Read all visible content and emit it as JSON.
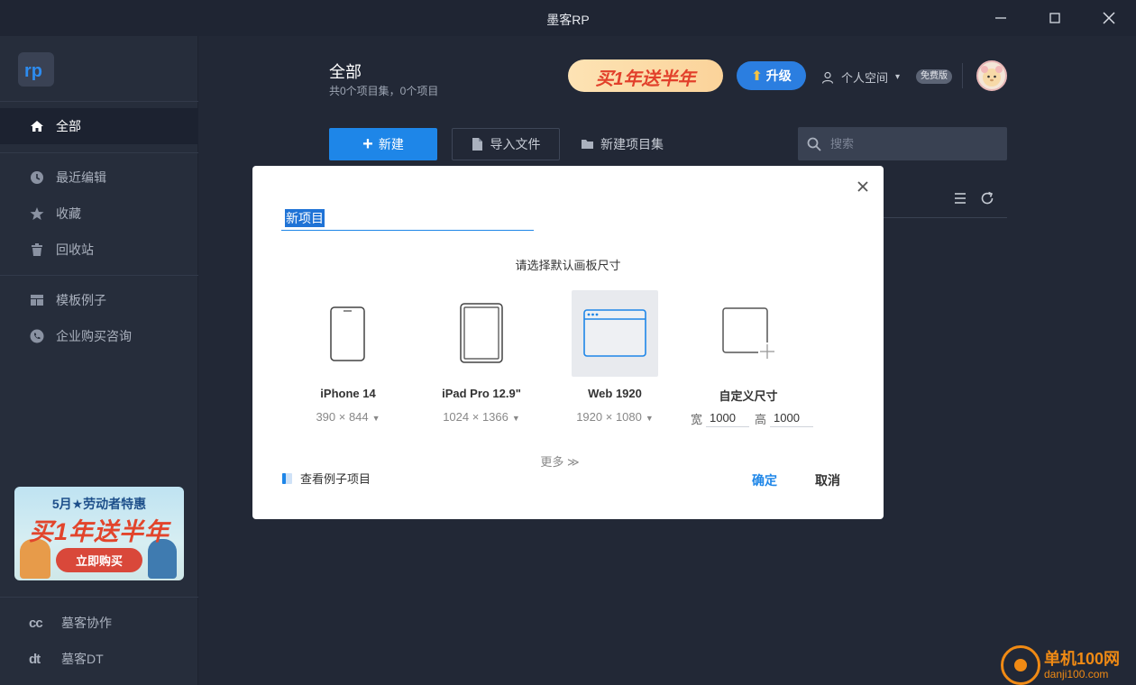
{
  "window": {
    "title": "墨客RP"
  },
  "sidebar": {
    "items": [
      {
        "label": "全部",
        "icon": "home-icon"
      },
      {
        "label": "最近编辑",
        "icon": "clock-icon"
      },
      {
        "label": "收藏",
        "icon": "star-icon"
      },
      {
        "label": "回收站",
        "icon": "trash-icon"
      },
      {
        "label": "模板例子",
        "icon": "template-icon"
      },
      {
        "label": "企业购买咨询",
        "icon": "phone-icon"
      }
    ],
    "promo": {
      "line1": "5月★劳动者特惠",
      "line2": "买1年送半年",
      "button": "立即购买"
    },
    "bottom": [
      {
        "label": "墓客协作",
        "icon_text": "cc"
      },
      {
        "label": "墓客DT",
        "icon_text": "dt"
      }
    ]
  },
  "header": {
    "title": "全部",
    "subtitle": "共0个项目集，0个项目",
    "banner": "买1年送半年",
    "upgrade": "升级",
    "space": "个人空间",
    "badge": "免费版"
  },
  "toolbar": {
    "new_label": "新建",
    "import_label": "导入文件",
    "new_set_label": "新建项目集",
    "search_placeholder": "搜索"
  },
  "dialog": {
    "name_value": "新项目",
    "choose_label": "请选择默认画板尺寸",
    "cards": [
      {
        "name": "iPhone 14",
        "size": "390 × 844"
      },
      {
        "name": "iPad Pro 12.9\"",
        "size": "1024 × 1366"
      },
      {
        "name": "Web 1920",
        "size": "1920 × 1080"
      },
      {
        "name": "自定义尺寸",
        "width_label": "宽",
        "width": "1000",
        "height_label": "高",
        "height": "1000"
      }
    ],
    "selected": "Web 1920",
    "more": "更多 ≫",
    "example": "查看例子项目",
    "ok": "确定",
    "cancel": "取消"
  },
  "watermark": {
    "line1": "单机100网",
    "line2": "danji100.com"
  },
  "colors": {
    "accent": "#1e86e8",
    "sidebar_bg": "#262d3b",
    "main_bg": "#222836"
  }
}
